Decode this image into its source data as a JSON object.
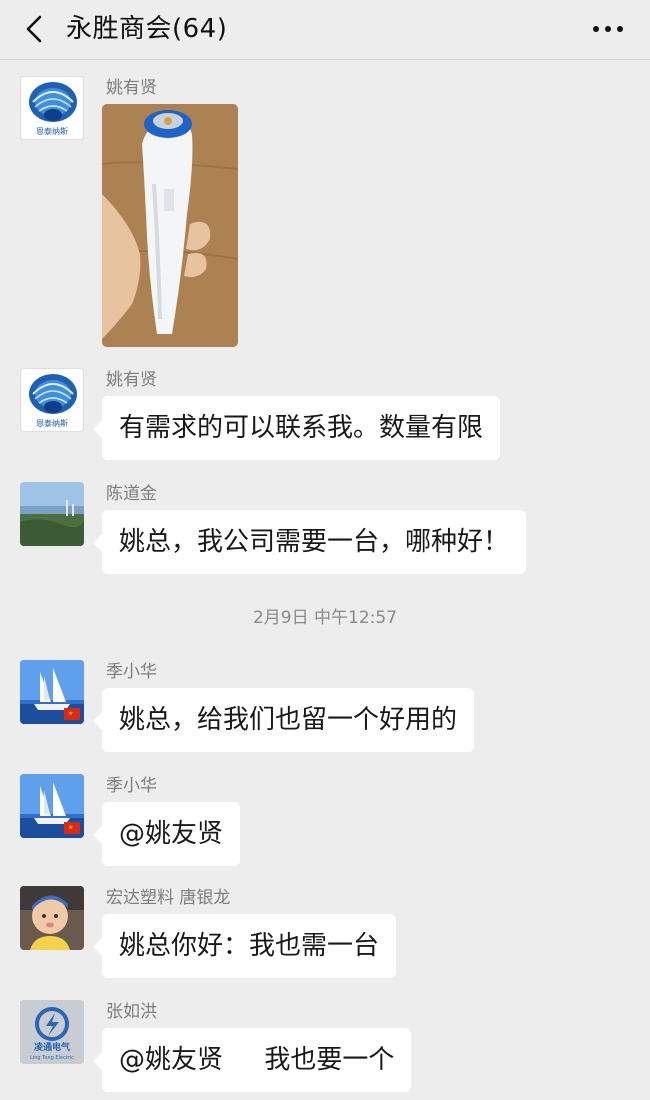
{
  "header": {
    "title": "永胜商会(64)",
    "back_icon": "chevron-left-icon",
    "more_icon": "more-dots-icon"
  },
  "messages": [
    {
      "sender": "姚有贤",
      "type": "image",
      "content": "thermometer-photo"
    },
    {
      "sender": "姚有贤",
      "type": "text",
      "text": "有需求的可以联系我。数量有限"
    },
    {
      "sender": "陈道金",
      "type": "text",
      "text": "姚总，我公司需要一台，哪种好！"
    },
    {
      "sender": "季小华",
      "type": "text",
      "text": "姚总，给我们也留一个好用的"
    },
    {
      "sender": "季小华",
      "type": "text",
      "text": "@姚友贤"
    },
    {
      "sender": "宏达塑料 唐银龙",
      "type": "text",
      "text": "姚总你好：我也需一台"
    },
    {
      "sender": "张如洪",
      "type": "text",
      "text": "@姚友贤     我也要一个"
    }
  ],
  "timestamp": "2月9日 中午12:57",
  "logo": {
    "avatar1_text": "恩泰纳斯",
    "avatar7_text": "凌通电气",
    "avatar7_sub": "Ling Tong Electric"
  },
  "colors": {
    "background": "#ededed",
    "bubble": "#ffffff",
    "sender": "#7d7d7d",
    "timestamp": "#8a8a8a"
  }
}
